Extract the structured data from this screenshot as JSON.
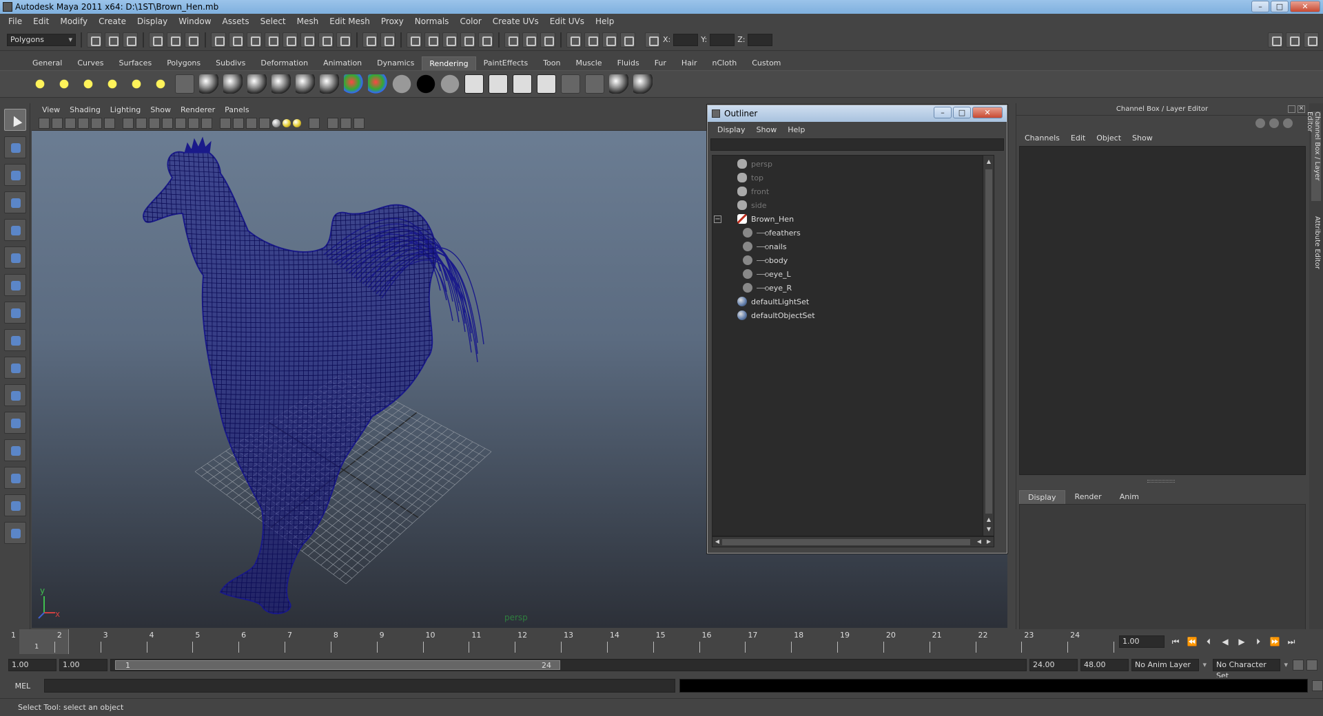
{
  "window": {
    "title": "Autodesk Maya 2011 x64: D:\\1ST\\Brown_Hen.mb",
    "minimize": "–",
    "maximize": "□",
    "close": "✕"
  },
  "menubar": [
    "File",
    "Edit",
    "Modify",
    "Create",
    "Display",
    "Window",
    "Assets",
    "Select",
    "Mesh",
    "Edit Mesh",
    "Proxy",
    "Normals",
    "Color",
    "Create UVs",
    "Edit UVs",
    "Help"
  ],
  "statusline": {
    "mode": "Polygons",
    "x_label": "X:",
    "y_label": "Y:",
    "z_label": "Z:"
  },
  "shelf": {
    "tabs": [
      "General",
      "Curves",
      "Surfaces",
      "Polygons",
      "Subdivs",
      "Deformation",
      "Animation",
      "Dynamics",
      "Rendering",
      "PaintEffects",
      "Toon",
      "Muscle",
      "Fluids",
      "Fur",
      "Hair",
      "nCloth",
      "Custom"
    ],
    "active_tab": "Rendering"
  },
  "viewport": {
    "menu": [
      "View",
      "Shading",
      "Lighting",
      "Show",
      "Renderer",
      "Panels"
    ],
    "camera": "persp",
    "axis_x": "x",
    "axis_y": "y",
    "wireframe_color": "#1a1a8a"
  },
  "outliner": {
    "title": "Outliner",
    "menu": [
      "Display",
      "Show",
      "Help"
    ],
    "expand_glyph": "−",
    "items": [
      {
        "label": "persp",
        "type": "camera",
        "dim": true,
        "indent": 0
      },
      {
        "label": "top",
        "type": "camera",
        "dim": true,
        "indent": 0
      },
      {
        "label": "front",
        "type": "camera",
        "dim": true,
        "indent": 0
      },
      {
        "label": "side",
        "type": "camera",
        "dim": true,
        "indent": 0
      },
      {
        "label": "Brown_Hen",
        "type": "transform",
        "dim": false,
        "indent": 0
      },
      {
        "label": "feathers",
        "type": "mesh",
        "dim": false,
        "indent": 1
      },
      {
        "label": "nails",
        "type": "mesh",
        "dim": false,
        "indent": 1
      },
      {
        "label": "body",
        "type": "mesh",
        "dim": false,
        "indent": 1
      },
      {
        "label": "eye_L",
        "type": "mesh",
        "dim": false,
        "indent": 1
      },
      {
        "label": "eye_R",
        "type": "mesh",
        "dim": false,
        "indent": 1
      },
      {
        "label": "defaultLightSet",
        "type": "set",
        "dim": false,
        "indent": 0
      },
      {
        "label": "defaultObjectSet",
        "type": "set",
        "dim": false,
        "indent": 0
      }
    ]
  },
  "channelbox": {
    "title": "Channel Box / Layer Editor",
    "menu": [
      "Channels",
      "Edit",
      "Object",
      "Show"
    ],
    "layer_tabs": [
      "Display",
      "Render",
      "Anim"
    ],
    "active_layer_tab": "Display"
  },
  "side_tabs": [
    "Channel Box / Layer Editor",
    "Attribute Editor"
  ],
  "timeslider": {
    "frames": [
      "1",
      "2",
      "3",
      "4",
      "5",
      "6",
      "7",
      "8",
      "9",
      "10",
      "11",
      "12",
      "13",
      "14",
      "15",
      "16",
      "17",
      "18",
      "19",
      "20",
      "21",
      "22",
      "23",
      "24"
    ],
    "current_frame": "1",
    "current_time": "1.00"
  },
  "rangeslider": {
    "start": "1.00",
    "playback_start": "1.00",
    "range_start": "1",
    "range_end": "24",
    "playback_end": "24.00",
    "end": "48.00",
    "anim_layer": "No Anim Layer",
    "character_set": "No Character Set"
  },
  "cmdline": {
    "label": "MEL"
  },
  "helpline": {
    "text": "Select Tool: select an object"
  }
}
